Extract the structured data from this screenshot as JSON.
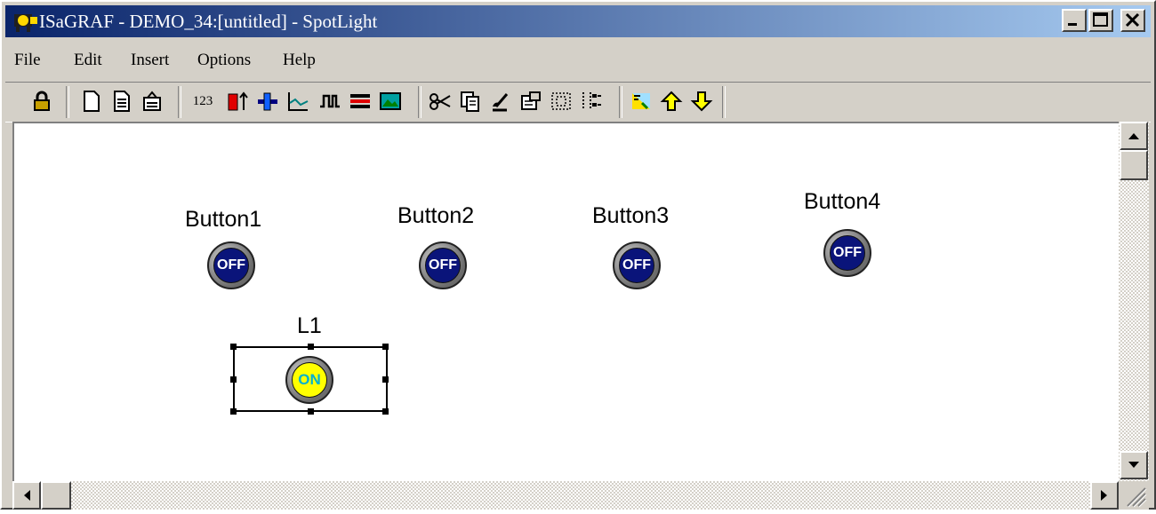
{
  "window": {
    "title": "ISaGRAF - DEMO_34:[untitled] - SpotLight",
    "controls": [
      "minimize",
      "maximize",
      "close"
    ]
  },
  "menu": [
    "File",
    "Edit",
    "Insert",
    "Options",
    "Help"
  ],
  "toolbar": {
    "number_label": "123",
    "buttons": [
      "lock-icon",
      "new-page-icon",
      "document-icon",
      "open-folder-icon",
      "number-icon",
      "bar-graph-icon",
      "slider-icon",
      "trend-icon",
      "digital-signal-icon",
      "multi-bar-icon",
      "picture-icon",
      "cut-icon",
      "copy-icon",
      "paint-icon",
      "properties-icon",
      "grid-icon",
      "align-icon",
      "palette-icon",
      "up-arrow-icon",
      "down-arrow-icon"
    ]
  },
  "canvas": {
    "buttons": [
      {
        "label": "Button1",
        "state": "OFF"
      },
      {
        "label": "Button2",
        "state": "OFF"
      },
      {
        "label": "Button3",
        "state": "OFF"
      },
      {
        "label": "Button4",
        "state": "OFF"
      }
    ],
    "lamp": {
      "label": "L1",
      "state": "ON",
      "selected": true
    }
  },
  "colors": {
    "off_fill": "#0a147a",
    "on_fill": "#ffff00",
    "on_text": "#00b0d0",
    "title_bar": "#0a246a"
  }
}
